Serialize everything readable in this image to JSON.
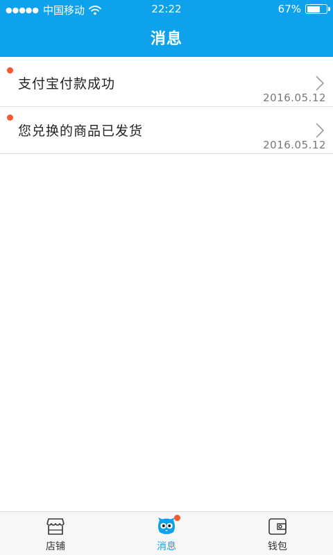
{
  "status_bar": {
    "signal_dots": "●●●●●",
    "carrier": "中国移动",
    "time": "22:22",
    "battery_percent": "67%",
    "battery_level": 0.67
  },
  "header": {
    "title": "消息"
  },
  "messages": [
    {
      "text": "支付宝付款成功",
      "date": "2016.05.12",
      "unread": true
    },
    {
      "text": "您兑换的商品已发货",
      "date": "2016.05.12",
      "unread": true
    }
  ],
  "tabbar": {
    "tabs": [
      {
        "label": "店铺",
        "icon": "store-icon"
      },
      {
        "label": "消息",
        "icon": "owl-message-icon",
        "active": true,
        "badge": true
      },
      {
        "label": "钱包",
        "icon": "wallet-icon"
      }
    ]
  },
  "colors": {
    "accent": "#0ea2ec",
    "badge": "#f25a33"
  }
}
